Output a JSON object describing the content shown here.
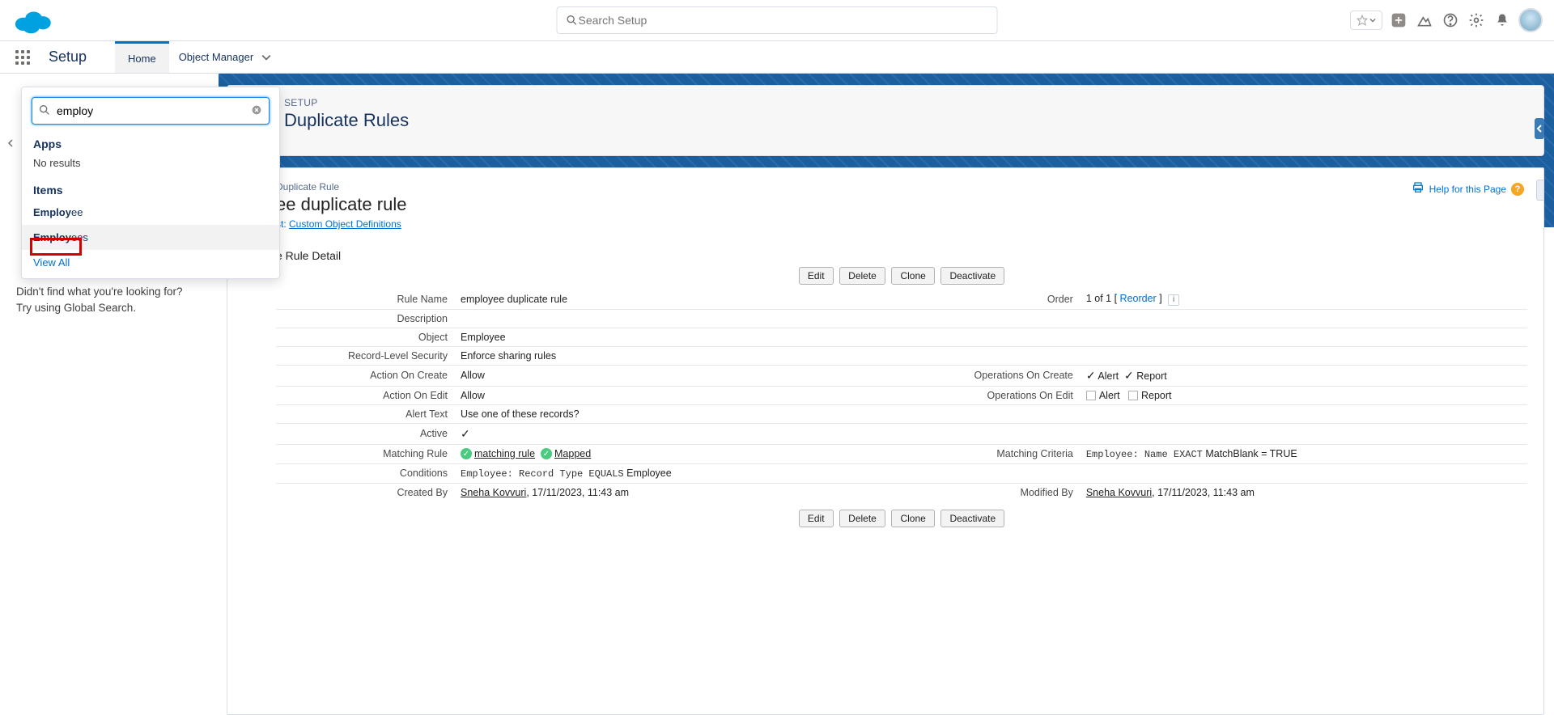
{
  "global_search_placeholder": "Search Setup",
  "nav": {
    "setup_label": "Setup",
    "home_label": "Home",
    "object_manager_label": "Object Manager"
  },
  "quickfind": {
    "value": "employ",
    "apps_heading": "Apps",
    "no_results": "No results",
    "items_heading": "Items",
    "item1_bold": "Employ",
    "item1_rest": "ee",
    "item2_bold": "Employ",
    "item2_rest": "ees",
    "view_all": "View All",
    "not_found_line1": "Didn't find what you're looking for?",
    "not_found_line2": "Try using Global Search."
  },
  "header": {
    "breadcrumb": "SETUP",
    "title": "Duplicate Rules"
  },
  "help_link": "Help for this Page",
  "rule": {
    "crumb": "Duplicate Rule",
    "title_suffix": "ee duplicate rule",
    "back_link_prefix": "st: ",
    "back_link": "Custom Object Definitions",
    "section_title_suffix": "e Rule Detail",
    "buttons": {
      "edit": "Edit",
      "delete": "Delete",
      "clone": "Clone",
      "deactivate": "Deactivate"
    },
    "labels": {
      "rule_name": "Rule Name",
      "description": "Description",
      "object": "Object",
      "record_level_security": "Record-Level Security",
      "action_on_create": "Action On Create",
      "action_on_edit": "Action On Edit",
      "alert_text": "Alert Text",
      "active": "Active",
      "matching_rule": "Matching Rule",
      "conditions": "Conditions",
      "created_by": "Created By",
      "order": "Order",
      "operations_on_create": "Operations On Create",
      "operations_on_edit": "Operations On Edit",
      "matching_criteria": "Matching Criteria",
      "modified_by": "Modified By"
    },
    "values": {
      "rule_name": "employee duplicate rule",
      "object": "Employee",
      "record_level_security": "Enforce sharing rules",
      "action_on_create": "Allow",
      "action_on_edit": "Allow",
      "alert_text": "Use one of these records?",
      "matching_rule_1": "matching rule",
      "matching_rule_2": "Mapped",
      "conditions_mono": "Employee: Record Type EQUALS",
      "conditions_tail": " Employee",
      "created_by_name": "Sneha Kovvuri",
      "created_by_ts": ", 17/11/2023, 11:43 am",
      "modified_by_name": "Sneha Kovvuri",
      "modified_by_ts": ", 17/11/2023, 11:43 am",
      "order_text": "1 of 1 [ ",
      "order_link": "Reorder",
      "order_tail": " ]",
      "op_alert": "Alert",
      "op_report": "Report",
      "criteria_mono1": "Employee:",
      "criteria_mono2": " Name EXACT",
      "criteria_tail": " MatchBlank = TRUE"
    }
  }
}
